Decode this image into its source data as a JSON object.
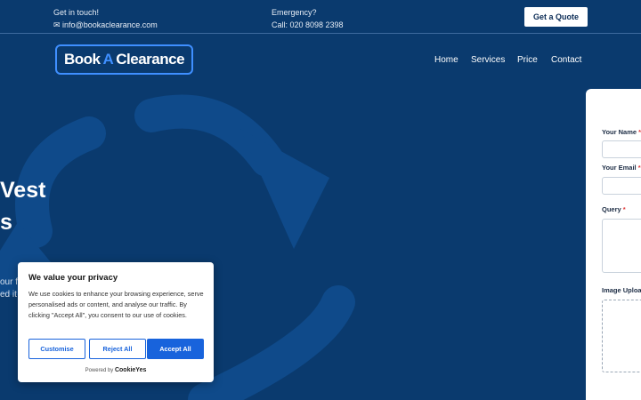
{
  "topbar": {
    "contact_label": "Get in touch!",
    "email": "✉ info@bookaclearance.com",
    "emergency_label": "Emergency?",
    "phone": "Call: 020 8098 2398",
    "quote_button": "Get a Quote"
  },
  "logo": {
    "part1": "Book",
    "part2": "A",
    "part3": "Clearance"
  },
  "nav": {
    "items": [
      "Home",
      "Services",
      "Price",
      "Contact"
    ]
  },
  "hero": {
    "title_line1": "Vest",
    "title_line2": "s",
    "text_line1": "our f",
    "text_line2": "ed it"
  },
  "form": {
    "name_label": "Your Name",
    "email_label": "Your Email",
    "query_label": "Query",
    "upload_label": "Image Upload",
    "required_mark": "*"
  },
  "cookie": {
    "title": "We value your privacy",
    "text": "We use cookies to enhance your browsing experience, serve personalised ads or content, and analyse our traffic. By clicking \"Accept All\", you consent to our use of cookies.",
    "customise": "Customise",
    "reject": "Reject All",
    "accept": "Accept All",
    "powered_by": "Powered by",
    "brand": "CookieYes"
  },
  "colors": {
    "background": "#0a3a6e",
    "accent": "#3f8fff",
    "cookie_button": "#1863dc",
    "required": "#e03a3a"
  }
}
